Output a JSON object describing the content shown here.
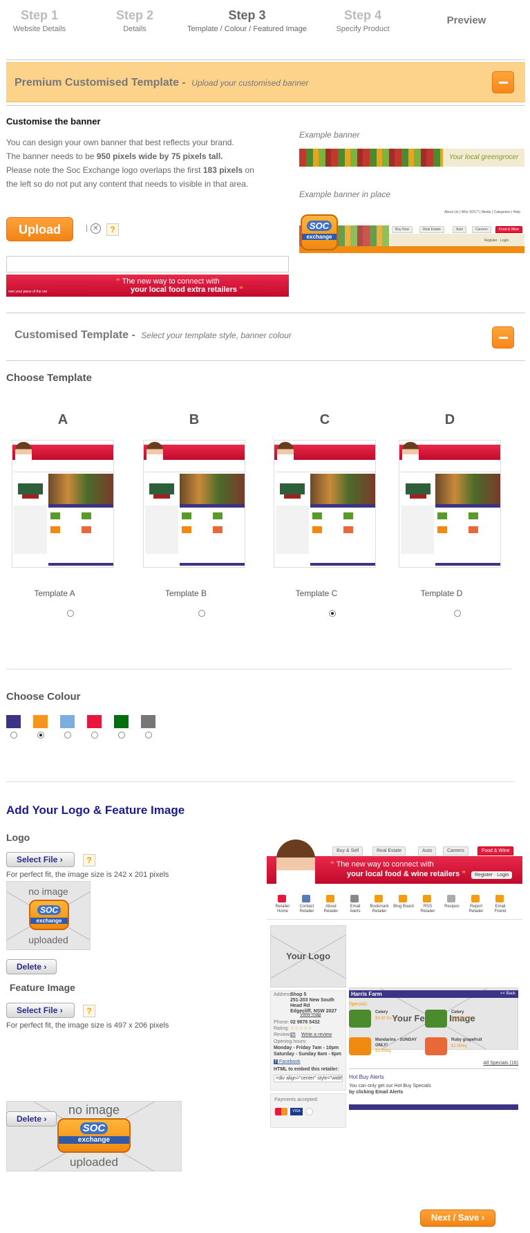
{
  "steps": [
    {
      "num": "Step 1",
      "label": "Website Details"
    },
    {
      "num": "Step 2",
      "label": "Details"
    },
    {
      "num": "Step 3",
      "label": "Template / Colour / Featured Image"
    },
    {
      "num": "Step 4",
      "label": "Specify Product"
    },
    {
      "num": "Preview",
      "label": ""
    }
  ],
  "premium": {
    "title": "Premium Customised Template -",
    "subtitle": "Upload your customised banner",
    "customise_heading": "Customise the banner",
    "para1": "You can design your own banner that best reflects your brand.",
    "para2_pre": "The banner needs to be ",
    "para2_bold": "950 pixels wide by 75 pixels tall.",
    "para3_pre": "Please note the Soc Exchange logo overlaps the first ",
    "para3_bold": "183 pixels",
    "para3_post": " on",
    "para4": "the left so do not put any content that needs to visible in that area.",
    "example_banner": "Example banner",
    "example_in_place": "Example banner in place",
    "upload_label": "Upload",
    "help_icon": "?",
    "banner_quote1": "The new way to connect with",
    "banner_quote2": "your local food extra retailers",
    "banner_small": "own your piece of the net",
    "example_green": "Your local greengrocer"
  },
  "example_place": {
    "toplinks": "About Us  |  Why SOC?  |  Media  |  Categories  |  Help",
    "soc": "SOC",
    "exchange": "exchange",
    "tabs": [
      "Buy Now",
      "Real Estate",
      "Auto",
      "Careers",
      "Food & Wine"
    ],
    "register": "Register",
    "login": "Login"
  },
  "customised": {
    "title": "Customised Template -",
    "subtitle": "Select your template style, banner colour"
  },
  "choose_template": {
    "heading": "Choose Template",
    "templates": [
      {
        "letter": "A",
        "label": "Template A",
        "selected": false
      },
      {
        "letter": "B",
        "label": "Template B",
        "selected": false
      },
      {
        "letter": "C",
        "label": "Template C",
        "selected": true
      },
      {
        "letter": "D",
        "label": "Template D",
        "selected": false
      }
    ]
  },
  "choose_colour": {
    "heading": "Choose Colour",
    "colours": [
      "#3b3486",
      "#f7941d",
      "#7aaee0",
      "#e8173e",
      "#00700f",
      "#777777"
    ],
    "selected_index": 1
  },
  "logo_section": {
    "heading": "Add Your Logo & Feature Image",
    "logo_label": "Logo",
    "select_file": "Select File",
    "logo_hint": "For perfect fit, the image size is 242 x 201 pixels",
    "no_image": "no image",
    "uploaded": "uploaded",
    "delete": "Delete",
    "feature_label": "Feature Image",
    "feature_hint": "For perfect fit, the image size is 497 x 206 pixels"
  },
  "preview": {
    "tabs": [
      "Buy & Sell",
      "Real Estate",
      "Auto",
      "Careers",
      "Food & Wine"
    ],
    "banner_line1": "The new way to connect with",
    "banner_line2": "your local food & wine retailers",
    "register_login": "Register · Login",
    "nav": [
      "Retailer Home",
      "Contact Retailer",
      "About Retailer",
      "Email Alerts",
      "Bookmark Retailer",
      "Blog Board",
      "RSS Retailer",
      "Recipes",
      "Report Retailer",
      "Email Friend"
    ],
    "your_logo": "Your Logo",
    "your_feature": "Your Feature Image",
    "store_name": "Harris Farm",
    "back": "<< Back",
    "specials": "Specials",
    "address_label": "Address:",
    "address": "Shop 5\n251-203 New South Head Rd\nEdgecliff, NSW 2027",
    "view_map": "View map",
    "phone_label": "Phone:",
    "phone": "02 9876 5432",
    "rating_label": "Rating:",
    "reviews_label": "Reviews:",
    "reviews": "25",
    "write_review": "Write a review",
    "opening_hours": "Opening hours:",
    "hours1": "Monday - Friday 7am - 10pm",
    "hours2": "Saturday - Sunday 8am - 6pm",
    "facebook": "Facebook",
    "embed": "HTML to embed this retailer:",
    "embed_code": "<div align=\"center\" style=\"width:230;",
    "payments": "Payments accepted:",
    "products": [
      {
        "name": "Celery",
        "price": "$3.00 for 2"
      },
      {
        "name": "Celery",
        "price": "$3.00 for 2"
      },
      {
        "name": "Mandarins - SUNDAY ONLY!",
        "price": "$3.99/kg"
      },
      {
        "name": "Ruby grapefruit",
        "price": "$1.99/kg"
      }
    ],
    "all_specials": "All Specials (16)",
    "hot_buy": "Hot Buy Alerts",
    "hot_buy_text1": "You can only get our Hot Buy Specials",
    "hot_buy_text2": "by clicking Email Alerts"
  },
  "next_save": "Next / Save"
}
